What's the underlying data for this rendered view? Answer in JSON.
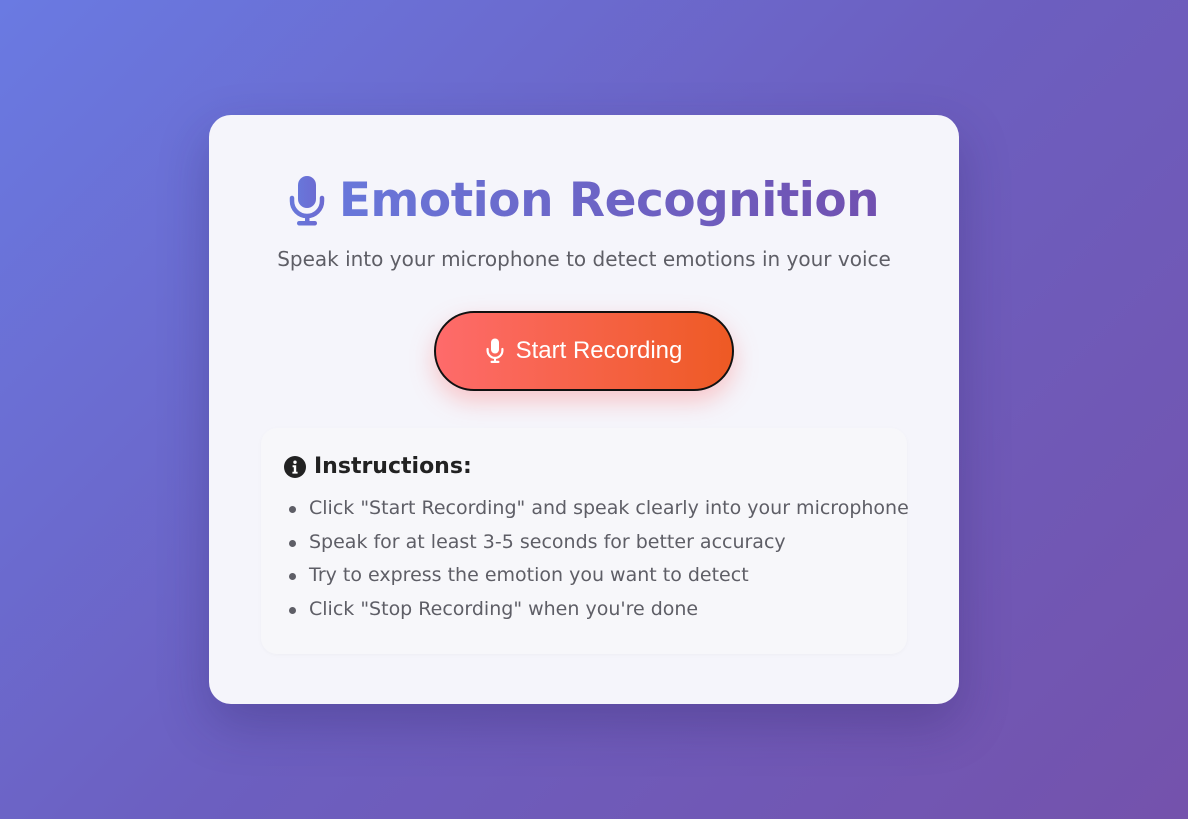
{
  "app": {
    "title": "Emotion Recognition",
    "subtitle": "Speak into your microphone to detect emotions in your voice",
    "title_icon": "microphone-icon"
  },
  "record_button": {
    "label": "Start Recording",
    "icon": "microphone-icon"
  },
  "instructions": {
    "title": "Instructions:",
    "icon": "info-circle-icon",
    "items": [
      "Click \"Start Recording\" and speak clearly into your microphone",
      "Speak for at least 3-5 seconds for better accuracy",
      "Try to express the emotion you want to detect",
      "Click \"Stop Recording\" when you're done"
    ]
  },
  "colors": {
    "background_start": "#6a7ae2",
    "background_end": "#7452ac",
    "title_gradient_start": "#6877da",
    "title_gradient_end": "#7150b0",
    "button_gradient_start": "#fe6b6b",
    "button_gradient_end": "#ee5a24",
    "card_background": "#f5f5fb"
  }
}
